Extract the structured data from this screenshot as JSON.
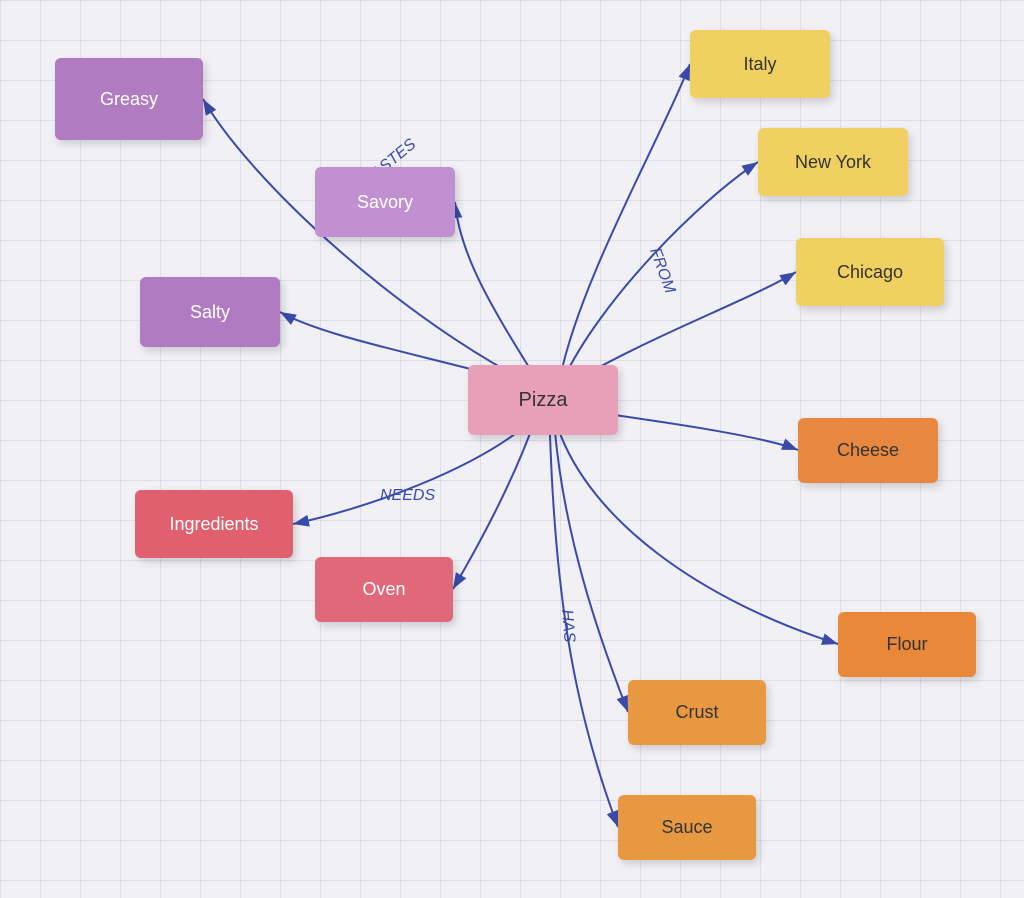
{
  "nodes": {
    "pizza": "Pizza",
    "greasy": "Greasy",
    "savory": "Savory",
    "salty": "Salty",
    "italy": "Italy",
    "newyork": "New York",
    "chicago": "Chicago",
    "ingredients": "Ingredients",
    "oven": "Oven",
    "cheese": "Cheese",
    "crust": "Crust",
    "flour": "Flour",
    "sauce": "Sauce"
  },
  "labels": {
    "tastes": "TASTES",
    "from": "FROM",
    "needs": "NEEDS",
    "has": "HAS"
  },
  "colors": {
    "arrow": "#3a4aaa"
  }
}
